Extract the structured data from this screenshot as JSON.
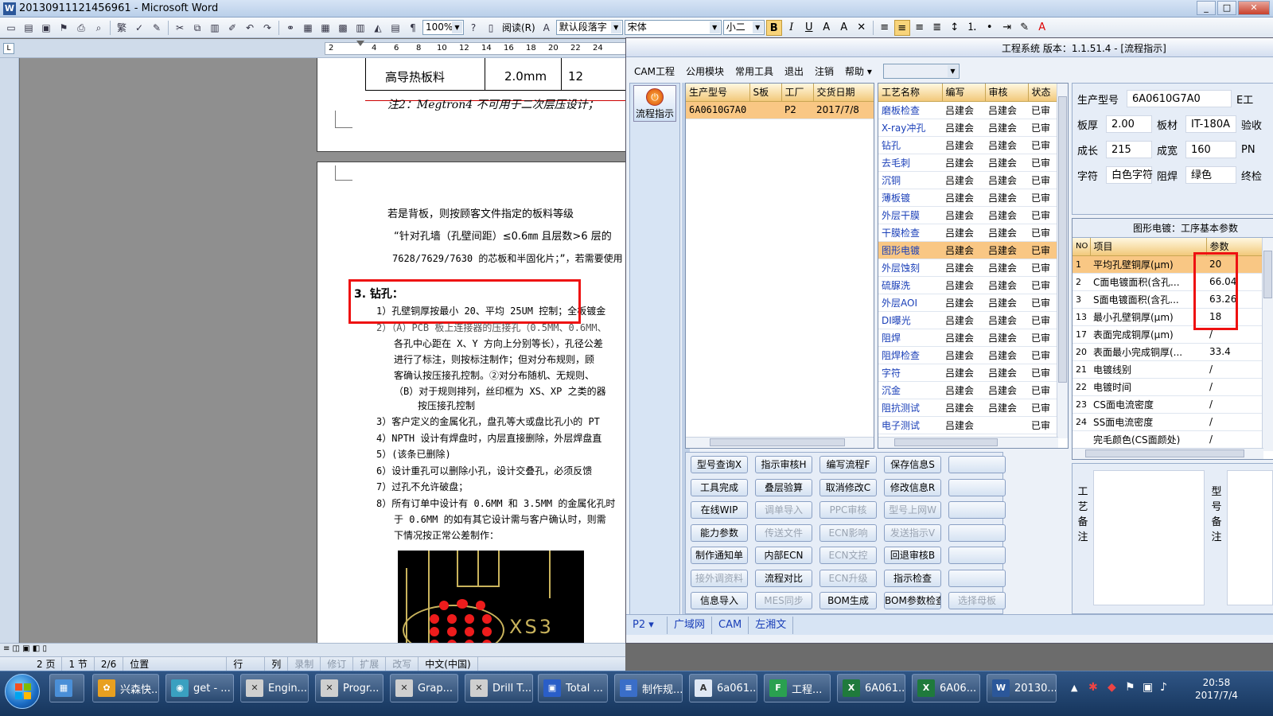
{
  "word": {
    "title": "20130911121456961 - Microsoft Word",
    "zoom": "100%",
    "read_label": "阅读(R)",
    "style": "默认段落字",
    "font": "宋体",
    "size": "小二",
    "ruler_ticks": [
      "2",
      "2",
      "4",
      "6",
      "8",
      "10",
      "12",
      "14",
      "16",
      "18",
      "20",
      "22",
      "24"
    ],
    "page1": {
      "cell_material": "高导热板料",
      "cell_thick": "2.0mm",
      "cell_extra": "12",
      "note": "注2：Megtron4 不可用于二次层压设计；"
    },
    "page2": {
      "l1": "若是背板，则按顾客文件指定的板料等级",
      "l2": "“针对孔墙（孔壁间距）≤0.6㎜ 且层数>6 层的",
      "l3": "7628/7629/7630 的芯板和半固化片；”，若需要使用",
      "h3": "3.   钻孔：",
      "i1": "1）孔壁铜厚按最小 20、平均 25UM 控制；全板镀金",
      "i2": "2）（A）PCB 板上连接器的压接孔（0.5MM、0.6MM、",
      "i2b": "各孔中心距在 X、Y 方向上分别等长），孔径公差",
      "i2c": "进行了标注，则按标注制作；但对分布规则，顾",
      "i2d": "客确认按压接孔控制。②对分布随机、无规则、",
      "i2e": "（B）对于规则排列，丝印框为 XS、XP 之类的器",
      "i2f": "按压接孔控制",
      "i3": "3）客户定义的金属化孔，盘孔等大或盘比孔小的 PT",
      "i4": "4）NPTH 设计有焊盘时，内层直接删除，外层焊盘直",
      "i5": "5）(该条已删除)",
      "i6": "6）设计重孔可以删除小孔，设计交叠孔，必须反馈",
      "i7": "7）过孔不允许破盘；",
      "i8": "8）所有订单中设计有 0.6MM 和 3.5MM 的金属化孔时",
      "i8b": "于 0.6MM 的如有其它设计需与客户确认时，则需",
      "i8c": "下情况按正常公差制作：",
      "pcb_label": "XS3"
    },
    "status": {
      "page": "2 页",
      "section": "1 节",
      "count": "2/6",
      "pos": "位置",
      "row": "行",
      "col": "列",
      "rec": "录制",
      "rev": "修订",
      "ext": "扩展",
      "ovr": "改写",
      "lang": "中文(中国)"
    }
  },
  "eng": {
    "title": "工程系统   版本：1.1.51.4 - [流程指示]",
    "menu": [
      "CAM工程",
      "公用模块",
      "常用工具",
      "退出",
      "注销",
      "帮助"
    ],
    "menu_arrow": "▾",
    "flow_button": "流程指示",
    "orders": {
      "headers": [
        "生产型号",
        "S板",
        "工厂",
        "交货日期"
      ],
      "rows": [
        [
          "6A0610G7A0",
          "",
          "P2",
          "2017/7/8"
        ]
      ]
    },
    "process": {
      "headers": [
        "工艺名称",
        "编写",
        "审核",
        "状态"
      ],
      "rows": [
        [
          "磨板检查",
          "吕建会",
          "吕建会",
          "已审"
        ],
        [
          "X-ray冲孔",
          "吕建会",
          "吕建会",
          "已审"
        ],
        [
          "钻孔",
          "吕建会",
          "吕建会",
          "已审"
        ],
        [
          "去毛刺",
          "吕建会",
          "吕建会",
          "已审"
        ],
        [
          "沉铜",
          "吕建会",
          "吕建会",
          "已审"
        ],
        [
          "薄板镀",
          "吕建会",
          "吕建会",
          "已审"
        ],
        [
          "外层干膜",
          "吕建会",
          "吕建会",
          "已审"
        ],
        [
          "干膜检查",
          "吕建会",
          "吕建会",
          "已审"
        ],
        [
          "图形电镀",
          "吕建会",
          "吕建会",
          "已审"
        ],
        [
          "外层蚀刻",
          "吕建会",
          "吕建会",
          "已审"
        ],
        [
          "硫脲洗",
          "吕建会",
          "吕建会",
          "已审"
        ],
        [
          "外层AOI",
          "吕建会",
          "吕建会",
          "已审"
        ],
        [
          "DI曝光",
          "吕建会",
          "吕建会",
          "已审"
        ],
        [
          "阻焊",
          "吕建会",
          "吕建会",
          "已审"
        ],
        [
          "阻焊检查",
          "吕建会",
          "吕建会",
          "已审"
        ],
        [
          "字符",
          "吕建会",
          "吕建会",
          "已审"
        ],
        [
          "沉金",
          "吕建会",
          "吕建会",
          "已审"
        ],
        [
          "阻抗测试",
          "吕建会",
          "吕建会",
          "已审"
        ],
        [
          "电子测试",
          "吕建会",
          "",
          "已审"
        ]
      ],
      "selected": 8
    },
    "info": {
      "model_label": "生产型号",
      "model": "6A0610G7A0",
      "model_tail": "E工",
      "thick_label": "板厚",
      "thick": "2.00",
      "mat_label": "板材",
      "mat": "IT-180A",
      "mat_tail": "验收",
      "len_label": "成长",
      "len": "215",
      "wid_label": "成宽",
      "wid": "160",
      "wid_tail": "PN",
      "char_label": "字符",
      "char": "白色字符",
      "mask_label": "阻焊",
      "mask": "绿色",
      "mask_tail": "终检"
    },
    "param": {
      "title": "图形电镀：工序基本参数",
      "headers": [
        "NO",
        "项目",
        "参数"
      ],
      "rows": [
        [
          "1",
          "平均孔壁铜厚(μm)",
          "20"
        ],
        [
          "2",
          "C面电镀面积(含孔...",
          "66.04"
        ],
        [
          "3",
          "S面电镀面积(含孔...",
          "63.26"
        ],
        [
          "13",
          "最小孔壁铜厚(μm)",
          "18"
        ],
        [
          "17",
          "表面完成铜厚(μm)",
          "/"
        ],
        [
          "20",
          "表面最小完成铜厚(...",
          "33.4"
        ],
        [
          "21",
          "电镀线别",
          "/"
        ],
        [
          "22",
          "电镀时间",
          "/"
        ],
        [
          "23",
          "CS面电流密度",
          "/"
        ],
        [
          "24",
          "SS面电流密度",
          "/"
        ],
        [
          "",
          "完毛颜色(CS面颜处)",
          "/"
        ]
      ]
    },
    "buttons": [
      [
        {
          "t": "型号查询X",
          "d": false
        },
        {
          "t": "指示审核H",
          "d": false
        },
        {
          "t": "编写流程F",
          "d": false
        },
        {
          "t": "保存信息S",
          "d": false
        },
        {
          "t": "",
          "d": false
        }
      ],
      [
        {
          "t": "工具完成",
          "d": false
        },
        {
          "t": "叠层验算",
          "d": false
        },
        {
          "t": "取消修改C",
          "d": false
        },
        {
          "t": "修改信息R",
          "d": false
        },
        {
          "t": "",
          "d": false
        }
      ],
      [
        {
          "t": "在线WIP",
          "d": false
        },
        {
          "t": "调单导入",
          "d": true
        },
        {
          "t": "PPC审核",
          "d": true
        },
        {
          "t": "型号上网W",
          "d": true
        },
        {
          "t": "",
          "d": false
        }
      ],
      [
        {
          "t": "能力参数",
          "d": false
        },
        {
          "t": "传送文件",
          "d": true
        },
        {
          "t": "ECN影响",
          "d": true
        },
        {
          "t": "发送指示V",
          "d": true
        },
        {
          "t": "",
          "d": false
        }
      ],
      [
        {
          "t": "制作通知单",
          "d": false
        },
        {
          "t": "内部ECN",
          "d": false
        },
        {
          "t": "ECN文控",
          "d": true
        },
        {
          "t": "回退审核B",
          "d": false
        },
        {
          "t": "",
          "d": false
        }
      ],
      [
        {
          "t": "接外调资料",
          "d": true
        },
        {
          "t": "流程对比",
          "d": false
        },
        {
          "t": "ECN升级",
          "d": true
        },
        {
          "t": "指示检查",
          "d": false
        },
        {
          "t": "",
          "d": false
        }
      ],
      [
        {
          "t": "信息导入",
          "d": false
        },
        {
          "t": "MES同步",
          "d": true
        },
        {
          "t": "BOM生成",
          "d": false
        },
        {
          "t": "BOM参数检查",
          "d": false
        },
        {
          "t": "选择母板",
          "d": true
        }
      ]
    ],
    "remark_process": "工艺备注",
    "remark_model": "型号备注",
    "status": [
      "P2 ▾",
      "广域网",
      "CAM",
      "左湘文"
    ]
  },
  "taskbar": {
    "items": [
      {
        "label": "",
        "color": "#4a8fd8",
        "icon": "calculator-icon",
        "glyph": "▦"
      },
      {
        "label": "兴森快...",
        "color": "#e8a020",
        "icon": "shell-icon",
        "glyph": "✿"
      },
      {
        "label": "get - ...",
        "color": "#3aa0c0",
        "icon": "eye-icon",
        "glyph": "◉"
      },
      {
        "label": "Engin...",
        "color": "#cfcfcf",
        "icon": "app-x-icon",
        "glyph": "✕"
      },
      {
        "label": "Progr...",
        "color": "#cfcfcf",
        "icon": "app-x-icon",
        "glyph": "✕"
      },
      {
        "label": "Grap...",
        "color": "#cfcfcf",
        "icon": "app-x-icon",
        "glyph": "✕"
      },
      {
        "label": "Drill T...",
        "color": "#cfcfcf",
        "icon": "app-x-icon",
        "glyph": "✕"
      },
      {
        "label": "Total ...",
        "color": "#2a5ec8",
        "icon": "floppy-icon",
        "glyph": "▣"
      },
      {
        "label": "制作规...",
        "color": "#3a6ec8",
        "icon": "document-icon",
        "glyph": "≡"
      },
      {
        "label": "6a061...",
        "color": "#e0e8f4",
        "icon": "text-a-icon",
        "glyph": "A"
      },
      {
        "label": "工程...",
        "color": "#2aa050",
        "icon": "app-f-icon",
        "glyph": "F"
      },
      {
        "label": "6A061...",
        "color": "#1f7a3c",
        "icon": "excel-icon",
        "glyph": "X"
      },
      {
        "label": "6A06...",
        "color": "#1f7a3c",
        "icon": "excel-icon",
        "glyph": "X"
      },
      {
        "label": "20130...",
        "color": "#2b579a",
        "icon": "word-icon",
        "glyph": "W"
      }
    ],
    "time": "20:58",
    "date": "2017/7/4"
  }
}
